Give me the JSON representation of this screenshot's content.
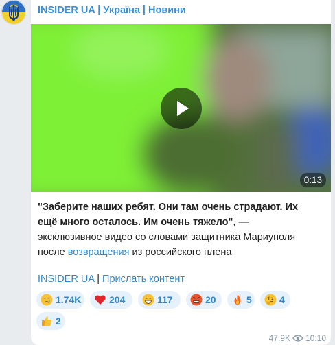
{
  "channel": {
    "name": "INSIDER UA | Україна | Новини",
    "avatar_icon": "trident-flag-icon"
  },
  "video": {
    "duration": "0:13",
    "play_icon": "play-icon"
  },
  "caption": {
    "quote": "\"Заберите наших ребят. Они там очень страдают. Их ещё много осталось. Им очень тяжело\"",
    "text_before_link": ", — эксклюзивное видео со словами защитника Мариуполя после ",
    "link_text": "возвращения",
    "text_after_link": " из российского плена"
  },
  "footer_links": {
    "channel_link": "INSIDER UA",
    "separator": " | ",
    "submit_link": "Прислать контент"
  },
  "reactions": [
    {
      "emoji": "crying-face-icon",
      "count": "1.74K"
    },
    {
      "emoji": "red-heart-icon",
      "count": "204"
    },
    {
      "emoji": "grinning-face-icon",
      "count": "117"
    },
    {
      "emoji": "angry-face-icon",
      "count": "20"
    },
    {
      "emoji": "fire-icon",
      "count": "5"
    },
    {
      "emoji": "thinking-face-icon",
      "count": "4"
    },
    {
      "emoji": "thumbs-up-icon",
      "count": "2"
    }
  ],
  "meta": {
    "views": "47.9K",
    "time": "10:10"
  },
  "colors": {
    "accent": "#3a8fd6",
    "link": "#2f86c9",
    "reaction_bg": "#e6f1fb",
    "background": "#e9ecef"
  }
}
